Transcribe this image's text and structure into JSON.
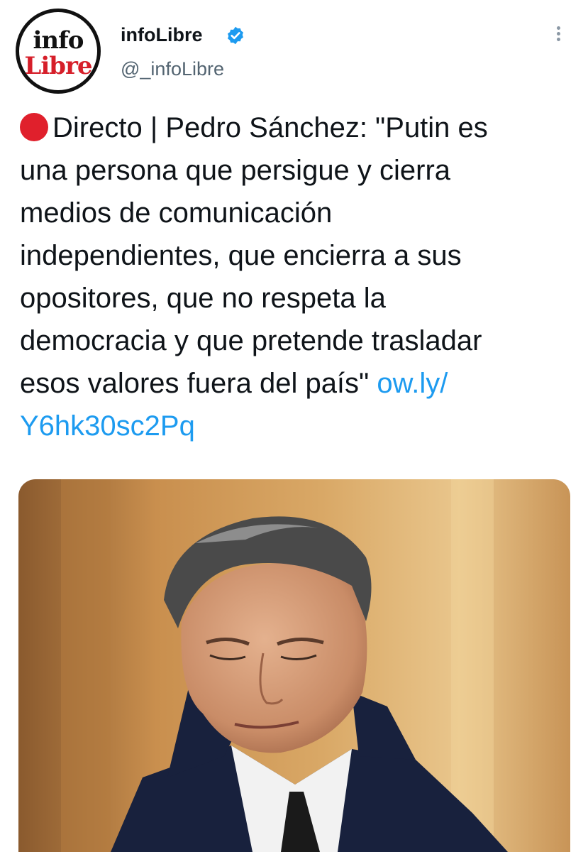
{
  "account": {
    "avatar_line1": "info",
    "avatar_line2": "Libre",
    "display_name": "infoLibre",
    "verified_icon": "verified-badge-icon",
    "handle": "@_infoLibre"
  },
  "menu_icon": "more-options-icon",
  "tweet": {
    "live_icon": "red-circle-icon",
    "text_line1": "Directo | Pedro Sánchez: \"Putin es",
    "text_line2": "una persona que persigue y cierra",
    "text_line3": "medios de comunicación",
    "text_line4": "independientes, que encierra a sus",
    "text_line5": "opositores, que no respeta la",
    "text_line6": "democracia y que pretende trasladar",
    "text_line7": "esos valores fuera del país\"",
    "link_part1": "ow.ly/",
    "link_part2": "Y6hk30sc2Pq"
  },
  "colors": {
    "link": "#1d9bf0",
    "handle": "#536471",
    "live_dot": "#e0202c",
    "avatar_red": "#d61f2a"
  },
  "media": {
    "type": "photo",
    "subject": "man-in-suit-looking-down"
  }
}
